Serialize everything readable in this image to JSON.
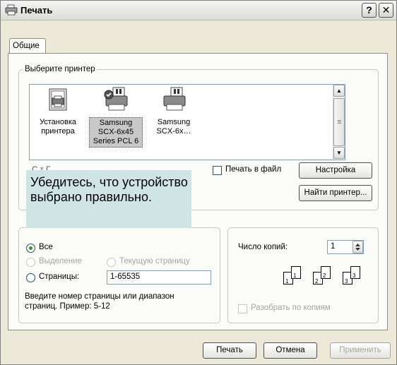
{
  "window": {
    "title": "Печать",
    "help_button": "?",
    "close_button": "✕"
  },
  "tabs": [
    {
      "label": "Общие"
    }
  ],
  "printer_group": {
    "legend": "Выберите принтер",
    "printers": [
      {
        "label": "Установка принтера",
        "icon": "add-printer-icon",
        "selected": false
      },
      {
        "label": "Samsung SCX-6x45 Series PCL 6",
        "icon": "printer-default-icon",
        "selected": true
      },
      {
        "label": "Samsung SCX-6x…",
        "icon": "printer-icon",
        "selected": false
      }
    ],
    "print_to_file": {
      "label": "Печать в файл",
      "checked": false
    },
    "preferences_button": "Настройка",
    "find_printer_button": "Найти принтер...",
    "status_partial": "С   т   Г"
  },
  "callout": {
    "text": "Убедитесь, что устройство выбрано правильно."
  },
  "page_range": {
    "all": {
      "label": "Все",
      "checked": true
    },
    "selection": {
      "label": "Выделение",
      "enabled": false
    },
    "current_page": {
      "label": "Текущую страницу",
      "enabled": false
    },
    "pages": {
      "label": "Страницы:",
      "value": "1-65535"
    },
    "hint": "Введите номер страницы или диапазон страниц.  Пример: 5-12"
  },
  "copies": {
    "label": "Число копий:",
    "value": "1",
    "collate": {
      "label": "Разобрать по копиям",
      "enabled": false,
      "checked": false
    }
  },
  "buttons": {
    "print": "Печать",
    "cancel": "Отмена",
    "apply": "Применить"
  },
  "colors": {
    "dialog_bg": "#ece9d8",
    "panel_bg": "#fbfbf8",
    "callout_bg": "#cfe5e5",
    "radio_dot": "#2b9c2b"
  }
}
